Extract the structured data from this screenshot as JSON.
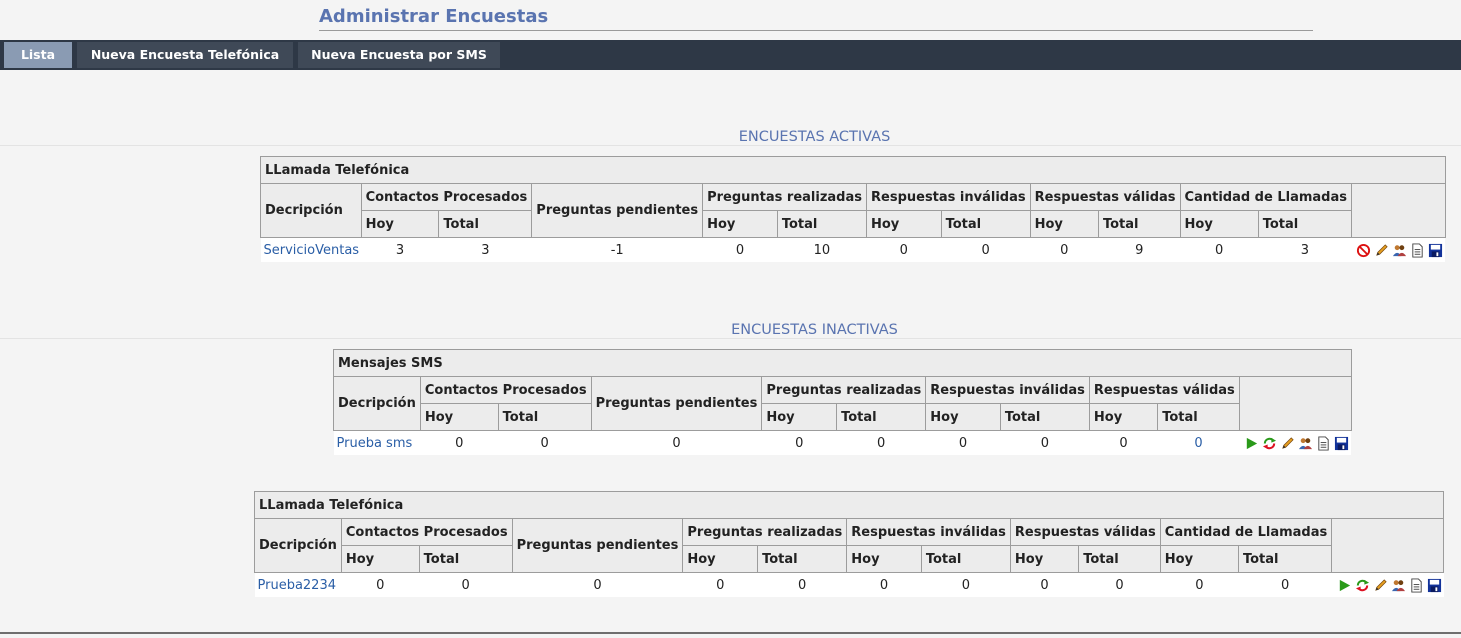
{
  "page": {
    "title": "Administrar Encuestas"
  },
  "tabs": [
    {
      "label": "Lista"
    },
    {
      "label": "Nueva Encuesta Telefónica"
    },
    {
      "label": "Nueva Encuesta por SMS"
    }
  ],
  "active": {
    "heading": "ENCUESTAS ACTIVAS",
    "table": {
      "caption": "LLamada Telefónica",
      "headers": {
        "desc": "Decripción",
        "contacts": "Contactos Procesados",
        "pending": "Preguntas pendientes",
        "asked": "Preguntas realizadas",
        "invalid": "Respuestas inválidas",
        "valid": "Respuestas válidas",
        "calls": "Cantidad de Llamadas",
        "today": "Hoy",
        "total": "Total"
      },
      "row": {
        "name": "ServicioVentas",
        "contacts_today": "3",
        "contacts_total": "3",
        "pending": "-1",
        "asked_today": "0",
        "asked_total": "10",
        "invalid_today": "0",
        "invalid_total": "0",
        "valid_today": "0",
        "valid_total": "9",
        "calls_today": "0",
        "calls_total": "3"
      },
      "icons": [
        "stop-icon",
        "edit-icon",
        "contacts-icon",
        "report-icon",
        "save-icon"
      ]
    }
  },
  "inactive": {
    "heading": "ENCUESTAS INACTIVAS",
    "sms": {
      "caption": "Mensajes SMS",
      "headers": {
        "desc": "Decripción",
        "contacts": "Contactos Procesados",
        "pending": "Preguntas pendientes",
        "asked": "Preguntas realizadas",
        "invalid": "Respuestas inválidas",
        "valid": "Respuestas válidas",
        "today": "Hoy",
        "total": "Total"
      },
      "row": {
        "name": "Prueba sms",
        "contacts_today": "0",
        "contacts_total": "0",
        "pending": "0",
        "asked_today": "0",
        "asked_total": "0",
        "invalid_today": "0",
        "invalid_total": "0",
        "valid_today": "0",
        "valid_total": "0"
      },
      "icons": [
        "play-icon",
        "refresh-icon",
        "edit-icon",
        "contacts-icon",
        "report-icon",
        "save-icon"
      ]
    },
    "phone": {
      "caption": "LLamada Telefónica",
      "headers": {
        "desc": "Decripción",
        "contacts": "Contactos Procesados",
        "pending": "Preguntas pendientes",
        "asked": "Preguntas realizadas",
        "invalid": "Respuestas inválidas",
        "valid": "Respuestas válidas",
        "calls": "Cantidad de Llamadas",
        "today": "Hoy",
        "total": "Total"
      },
      "row": {
        "name": "Prueba2234",
        "contacts_today": "0",
        "contacts_total": "0",
        "pending": "0",
        "asked_today": "0",
        "asked_total": "0",
        "invalid_today": "0",
        "invalid_total": "0",
        "valid_today": "0",
        "valid_total": "0",
        "calls_today": "0",
        "calls_total": "0"
      },
      "icons": [
        "play-icon",
        "refresh-icon",
        "edit-icon",
        "contacts-icon",
        "report-icon",
        "save-icon"
      ]
    }
  },
  "colors": {
    "accent": "#5a74b0",
    "tabbar": "#2e3846",
    "tab_active": "#8a9bb3",
    "link": "#2a5ea6"
  }
}
